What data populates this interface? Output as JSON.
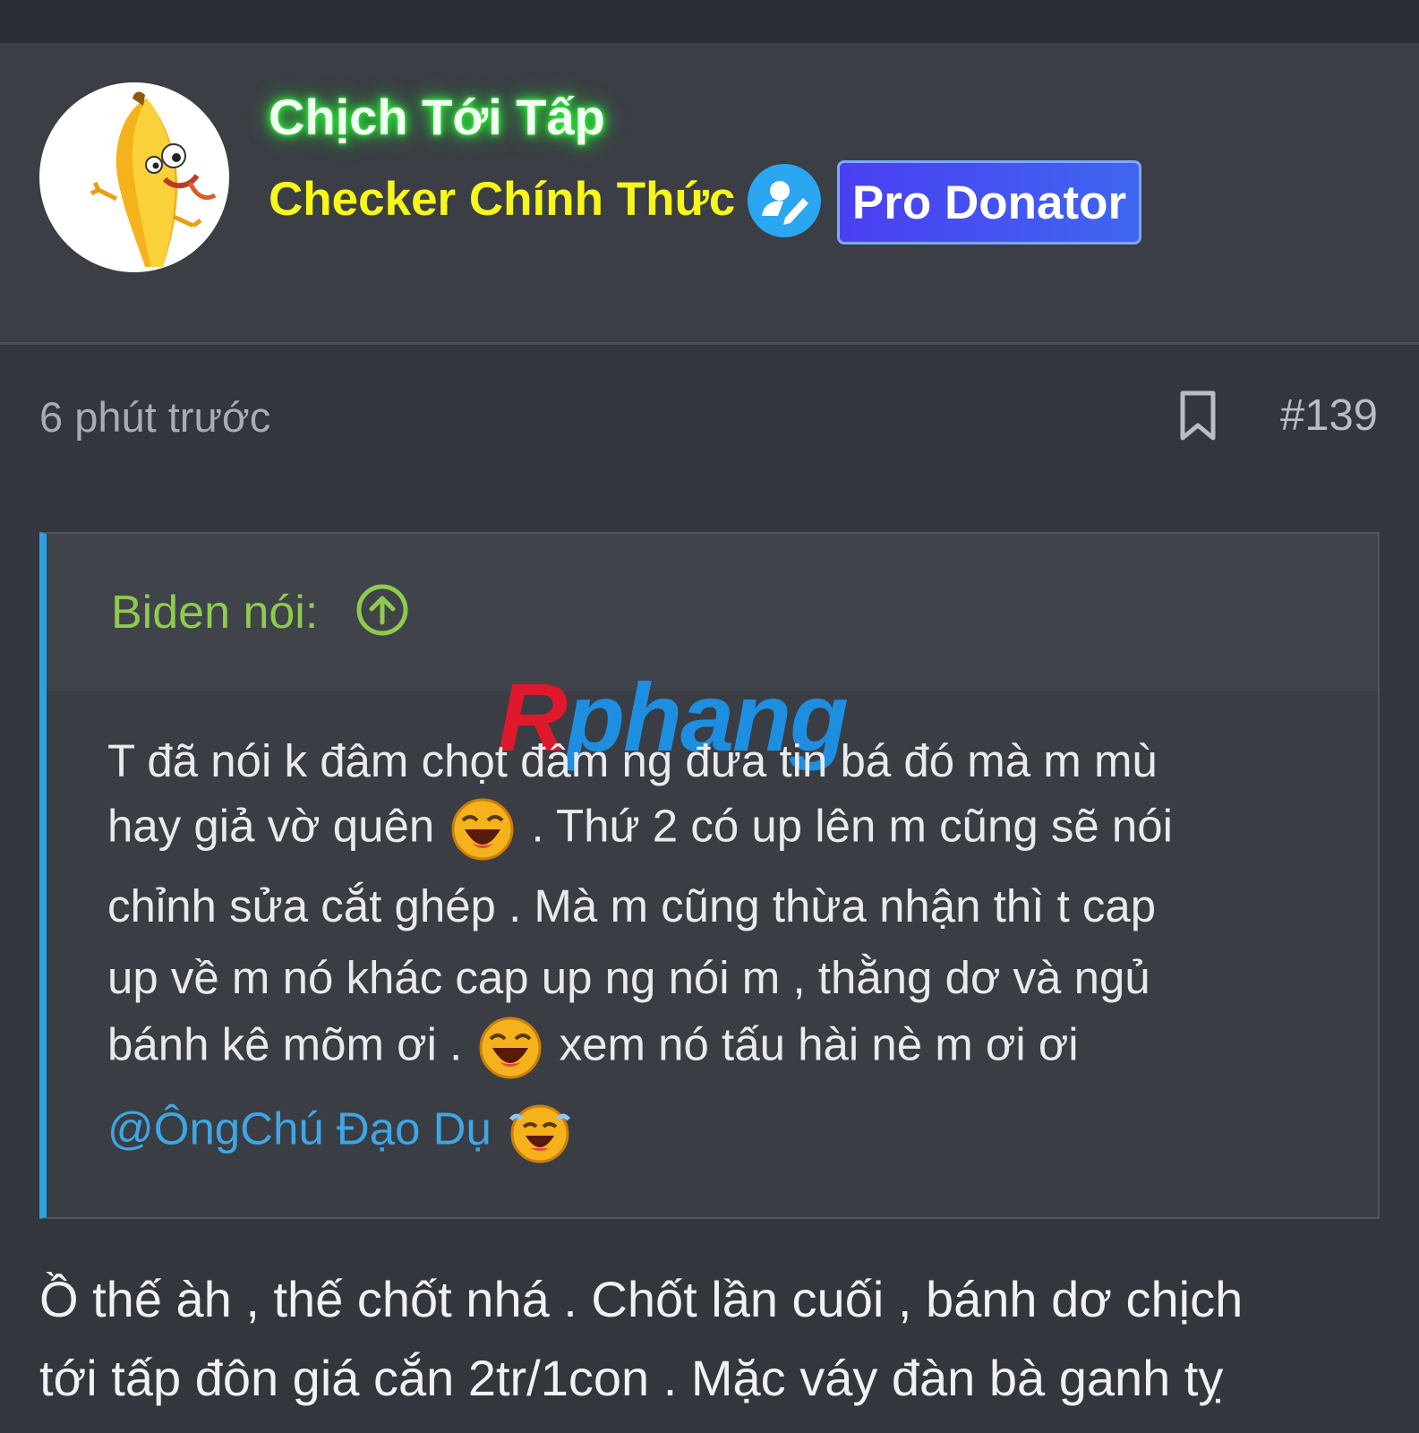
{
  "post": {
    "username": "Chịch Tới Tấp",
    "rank": "Checker Chính Thức",
    "badge": "Pro Donator",
    "time": "6 phút trước",
    "number": "#139"
  },
  "quote": {
    "author": "Biden nói:",
    "lines": {
      "l1": "T đã nói k đâm chọt đâm ng đưa tin bá đó mà m mù",
      "l2a": "hay giả vờ quên",
      "l2b": ". Thứ 2 có up lên m cũng sẽ nói",
      "l3": "chỉnh sửa cắt ghép . Mà m cũng thừa nhận thì t cap",
      "l4": "up về m nó khác cap up ng nói m , thằng dơ và ngủ",
      "l5a": "bánh kê mõm ơi .",
      "l5b": "xem nó tấu hài nè m ơi ơi"
    },
    "mention": "@ÔngChú Đạo Dụ"
  },
  "body": {
    "l1": "Ồ thế àh , thế chốt nhá . Chốt lần cuối , bánh dơ chịch",
    "l2": "tới tấp đôn giá cắn 2tr/1con . Mặc váy đàn bà ganh tỵ"
  },
  "watermark": {
    "r": "R",
    "rest": "phang"
  },
  "icons": {
    "verified": "verified-user-icon",
    "bookmark": "bookmark-icon",
    "quote_up": "arrow-up-circle-icon",
    "emoji": "laughing-emoji-icon"
  },
  "colors": {
    "username_glow": "#2bff3a",
    "rank": "#f7f71c",
    "quote_border": "#2ba1e6",
    "quote_author": "#8ecb4d",
    "mention": "#3ea6e2"
  }
}
